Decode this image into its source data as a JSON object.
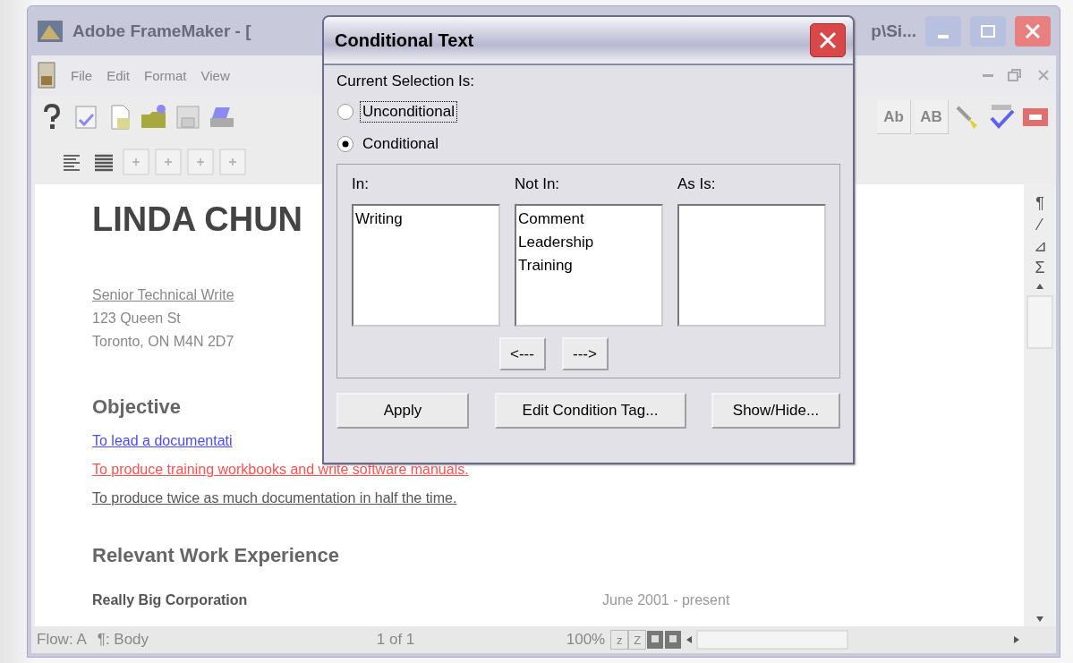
{
  "app": {
    "title_left": "Adobe FrameMaker - [",
    "title_right": "p\\Si...",
    "menu": [
      "File",
      "Edit",
      "Format",
      "View"
    ],
    "toolbar_labels": [
      "Ab",
      "AB"
    ],
    "ruler_symbols": [
      "¶",
      "⁄",
      "⊿",
      "Σ"
    ],
    "document": {
      "name": "LINDA CHUN",
      "blocks": [
        {
          "kind": "subtitle",
          "text": "Senior Technical Write"
        },
        {
          "kind": "plain",
          "text": "123 Queen St"
        },
        {
          "kind": "plain",
          "text": "Toronto, ON M4N 2D7"
        },
        {
          "kind": "heading",
          "text": "Objective"
        },
        {
          "kind": "conditional",
          "text": "To lead a documentati",
          "color": "#4a4aff"
        },
        {
          "kind": "conditional",
          "text": "To produce training workbooks and write software manuals.",
          "color": "#ff5050"
        },
        {
          "kind": "conditional",
          "text": "To produce twice as much documentation in half the time.",
          "color": "#555555"
        },
        {
          "kind": "heading",
          "text": "Relevant Work Experience"
        },
        {
          "kind": "job",
          "text": "Really Big Corporation",
          "date": "June 2001 - present"
        }
      ]
    },
    "status": {
      "flow": "Flow: A",
      "paragraph": "¶: Body",
      "page": "1 of 1",
      "zoom": "100%",
      "zoom_buttons": [
        "z",
        "Z"
      ]
    }
  },
  "dialog": {
    "title": "Conditional Text",
    "selection_label": "Current Selection Is:",
    "options": [
      {
        "label": "Unconditional",
        "selected": false,
        "focused": true
      },
      {
        "label": "Conditional",
        "selected": true,
        "focused": false
      }
    ],
    "lists": [
      {
        "label": "In:",
        "items": [
          "Writing"
        ]
      },
      {
        "label": "Not In:",
        "items": [
          "Comment",
          "Leadership",
          "Training"
        ]
      },
      {
        "label": "As Is:"
      }
    ],
    "move_buttons": [
      "<---",
      "--->"
    ],
    "buttons": [
      "Apply",
      "Edit Condition Tag...",
      "Show/Hide..."
    ]
  }
}
